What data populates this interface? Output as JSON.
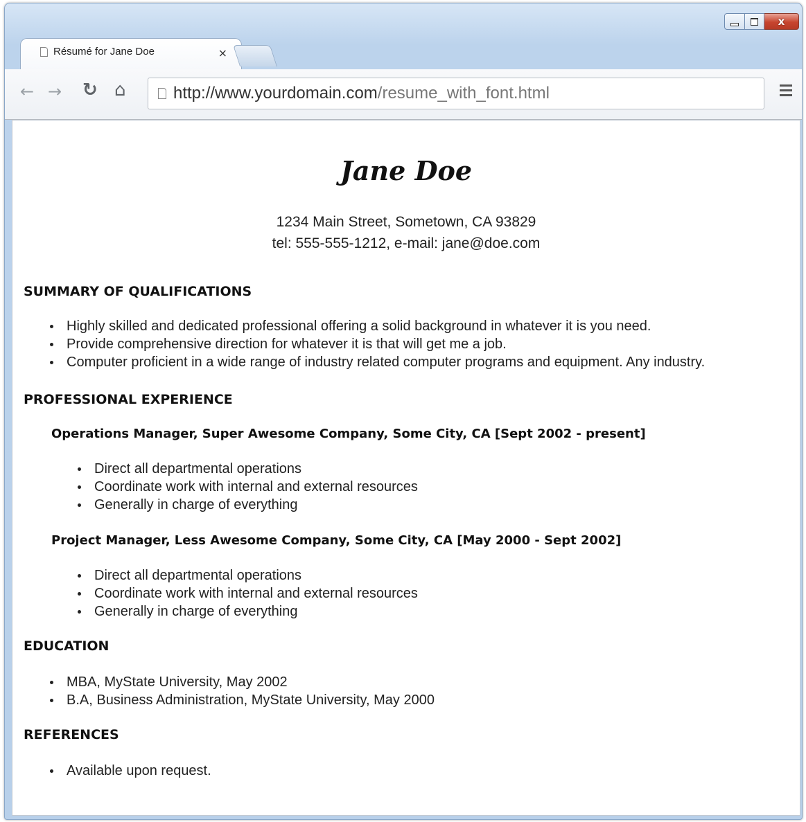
{
  "browser": {
    "tab_title": "Résumé for Jane Doe",
    "tab_close": "×",
    "url_host": "http://www.yourdomain.com",
    "url_path": "/resume_with_font.html",
    "window_close": "x"
  },
  "resume": {
    "name": "Jane Doe",
    "address_line": "1234 Main Street, Sometown, CA 93829",
    "contact_line": "tel: 555-555-1212, e-mail: jane@doe.com",
    "summary_heading": "SUMMARY OF QUALIFICATIONS",
    "summary_items": [
      "Highly skilled and dedicated professional offering a solid background in whatever it is you need.",
      "Provide comprehensive direction for whatever it is that will get me a job.",
      "Computer proficient in a wide range of industry related computer programs and equipment. Any industry."
    ],
    "experience_heading": "PROFESSIONAL EXPERIENCE",
    "jobs": [
      {
        "title": "Operations Manager, Super Awesome Company, Some City, CA [Sept 2002 - present]",
        "items": [
          "Direct all departmental operations",
          "Coordinate work with internal and external resources",
          "Generally in charge of everything"
        ]
      },
      {
        "title": "Project Manager, Less Awesome Company, Some City, CA [May 2000 - Sept 2002]",
        "items": [
          "Direct all departmental operations",
          "Coordinate work with internal and external resources",
          "Generally in charge of everything"
        ]
      }
    ],
    "education_heading": "EDUCATION",
    "education_items": [
      "MBA, MyState University, May 2002",
      "B.A, Business Administration, MyState University, May 2000"
    ],
    "references_heading": "REFERENCES",
    "references_items": [
      "Available upon request."
    ]
  }
}
